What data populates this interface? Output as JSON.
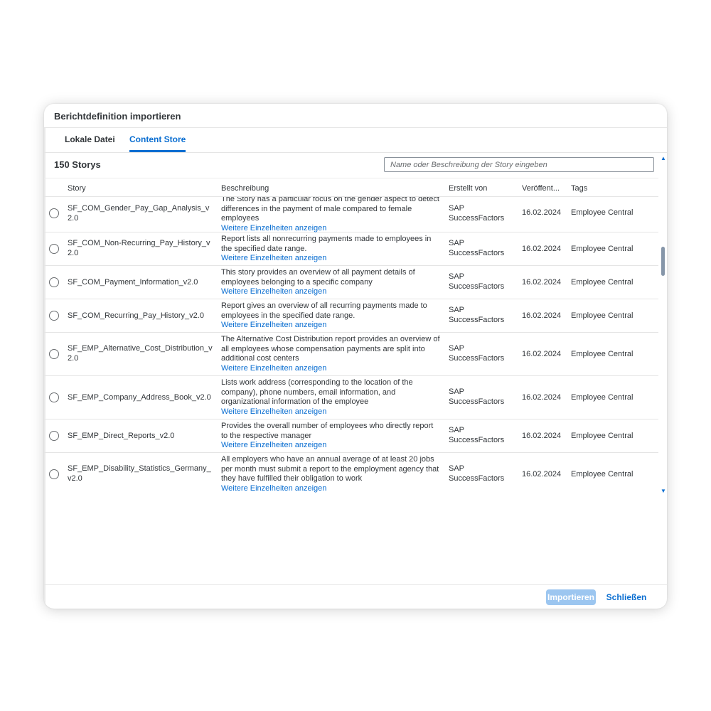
{
  "dialog": {
    "title": "Berichtdefinition importieren",
    "tabs": [
      {
        "label": "Lokale Datei",
        "active": false
      },
      {
        "label": "Content Store",
        "active": true
      }
    ],
    "count_label": "150 Storys",
    "search": {
      "placeholder": "Name oder Beschreibung der Story eingeben",
      "value": ""
    },
    "columns": [
      "Story",
      "Beschreibung",
      "Erstellt von",
      "Veröffent...",
      "Tags"
    ],
    "rows": [
      {
        "story": "SF_COM_Gender_Pay_Gap_Analysis_v2.0",
        "description": "The Story has a particular focus on the gender aspect to detect differences in the payment of male compared to female employees",
        "more": "Weitere Einzelheiten anzeigen",
        "created_by": "SAP SuccessFactors",
        "published": "16.02.2024",
        "tags": "Employee Central"
      },
      {
        "story": "SF_COM_Non-Recurring_Pay_History_v2.0",
        "description": "Report lists all nonrecurring payments made to employees in the specified date range.",
        "more": "Weitere Einzelheiten anzeigen",
        "created_by": "SAP SuccessFactors",
        "published": "16.02.2024",
        "tags": "Employee Central"
      },
      {
        "story": "SF_COM_Payment_Information_v2.0",
        "description": "This story provides an overview of all payment details of employees belonging to a specific company",
        "more": "Weitere Einzelheiten anzeigen",
        "created_by": "SAP SuccessFactors",
        "published": "16.02.2024",
        "tags": "Employee Central"
      },
      {
        "story": "SF_COM_Recurring_Pay_History_v2.0",
        "description": "Report gives an overview of all recurring payments made to employees in the specified date range.",
        "more": "Weitere Einzelheiten anzeigen",
        "created_by": "SAP SuccessFactors",
        "published": "16.02.2024",
        "tags": "Employee Central"
      },
      {
        "story": "SF_EMP_Alternative_Cost_Distribution_v2.0",
        "description": "The Alternative Cost Distribution report provides an overview of all employees whose compensation payments are split into additional cost centers",
        "more": "Weitere Einzelheiten anzeigen",
        "created_by": "SAP SuccessFactors",
        "published": "16.02.2024",
        "tags": "Employee Central"
      },
      {
        "story": "SF_EMP_Company_Address_Book_v2.0",
        "description": "Lists work address (corresponding to the location of the company), phone numbers, email information, and organizational information of the employee",
        "more": "Weitere Einzelheiten anzeigen",
        "created_by": "SAP SuccessFactors",
        "published": "16.02.2024",
        "tags": "Employee Central"
      },
      {
        "story": "SF_EMP_Direct_Reports_v2.0",
        "description": "Provides the overall number of employees who directly report to the respective manager",
        "more": "Weitere Einzelheiten anzeigen",
        "created_by": "SAP SuccessFactors",
        "published": "16.02.2024",
        "tags": "Employee Central"
      },
      {
        "story": "SF_EMP_Disability_Statistics_Germany_v2.0",
        "description": "All employers who have an annual average of at least 20 jobs per month must submit a report to the employment agency that they have fulfilled their obligation to work",
        "more": "Weitere Einzelheiten anzeigen",
        "created_by": "SAP SuccessFactors",
        "published": "16.02.2024",
        "tags": "Employee Central"
      }
    ],
    "footer": {
      "import_label": "Importieren",
      "close_label": "Schließen"
    }
  },
  "colors": {
    "accent": "#0a6ed1",
    "import_disabled": "#9cc6f0"
  }
}
